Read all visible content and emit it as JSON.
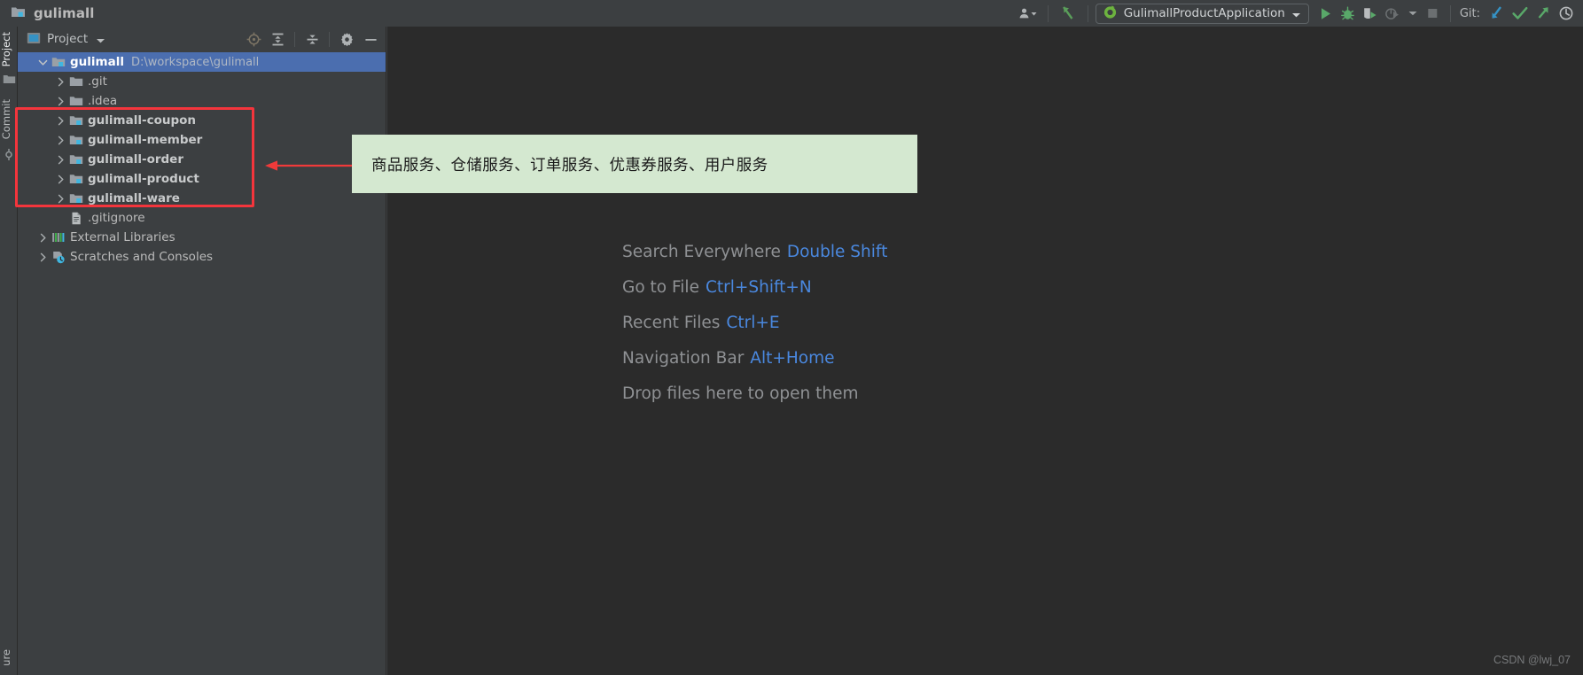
{
  "window": {
    "title": "gulimall",
    "title_icon": "module-folder-icon"
  },
  "toolbar": {
    "user_icon": "user-account-icon",
    "updates_icon": "update-project-icon",
    "run_configuration": {
      "label": "GulimallProductApplication",
      "icon": "spring-boot-icon",
      "dropdown_icon": "chevron-down-icon"
    },
    "run_icon": "run-icon",
    "debug_icon": "debug-icon",
    "run_coverage_icon": "run-with-coverage-icon",
    "profiler_icon": "profiler-icon",
    "profiler_dropdown_icon": "chevron-down-icon",
    "stop_icon": "stop-icon",
    "git_label": "Git:",
    "git_update_icon": "git-update-project-icon",
    "git_commit_icon": "git-commit-icon",
    "git_push_icon": "git-push-icon",
    "git_history_icon": "git-history-icon"
  },
  "rail": {
    "top_items": [
      {
        "label": "Project",
        "icon": "project-tool-icon",
        "active": true
      },
      {
        "label": "Commit",
        "icon": "commit-tool-icon",
        "active": false
      }
    ],
    "bottom_items": [
      {
        "label": "ure",
        "icon": "structure-tool-icon",
        "active": false
      }
    ]
  },
  "project_panel": {
    "title": "Project",
    "title_icon": "project-view-icon",
    "dropdown_icon": "chevron-down-icon",
    "actions": [
      {
        "name": "scroll-from-source-icon",
        "label": "Select Opened File"
      },
      {
        "name": "expand-all-icon",
        "label": "Expand All"
      },
      {
        "name": "collapse-all-icon",
        "label": "Collapse All"
      },
      {
        "name": "gear-icon",
        "label": "Options"
      },
      {
        "name": "hide-icon",
        "label": "Hide"
      }
    ],
    "tree": [
      {
        "label": "gulimall",
        "path": "D:\\workspace\\gulimall",
        "icon": "module-folder-icon",
        "indent": 0,
        "expanded": true,
        "selected": true,
        "style": "root"
      },
      {
        "label": ".git",
        "icon": "folder-icon",
        "indent": 1,
        "expanded": false,
        "style": "plain"
      },
      {
        "label": ".idea",
        "icon": "folder-icon",
        "indent": 1,
        "expanded": false,
        "style": "plain"
      },
      {
        "label": "gulimall-coupon",
        "icon": "module-folder-icon",
        "indent": 1,
        "expanded": false,
        "style": "module"
      },
      {
        "label": "gulimall-member",
        "icon": "module-folder-icon",
        "indent": 1,
        "expanded": false,
        "style": "module"
      },
      {
        "label": "gulimall-order",
        "icon": "module-folder-icon",
        "indent": 1,
        "expanded": false,
        "style": "module"
      },
      {
        "label": "gulimall-product",
        "icon": "module-folder-icon",
        "indent": 1,
        "expanded": false,
        "style": "module"
      },
      {
        "label": "gulimall-ware",
        "icon": "module-folder-icon",
        "indent": 1,
        "expanded": false,
        "style": "module"
      },
      {
        "label": ".gitignore",
        "icon": "gitignore-file-icon",
        "indent": 1,
        "expanded": null,
        "style": "plain"
      },
      {
        "label": "External Libraries",
        "icon": "libraries-icon",
        "indent": 0,
        "expanded": false,
        "style": "plain"
      },
      {
        "label": "Scratches and Consoles",
        "icon": "scratches-icon",
        "indent": 0,
        "expanded": false,
        "style": "plain"
      }
    ]
  },
  "editor": {
    "hints": [
      {
        "action": "Search Everywhere",
        "shortcut": "Double Shift"
      },
      {
        "action": "Go to File",
        "shortcut": "Ctrl+Shift+N"
      },
      {
        "action": "Recent Files",
        "shortcut": "Ctrl+E"
      },
      {
        "action": "Navigation Bar",
        "shortcut": "Alt+Home"
      },
      {
        "action": "Drop files here to open them",
        "shortcut": ""
      }
    ],
    "watermark": "CSDN @lwj_07"
  },
  "annotation": {
    "callout_text": "商品服务、仓储服务、订单服务、优惠券服务、用户服务",
    "box_color": "#f4353c",
    "callout_bg": "#d4e8d0",
    "arrow_color": "#f03a3a"
  }
}
